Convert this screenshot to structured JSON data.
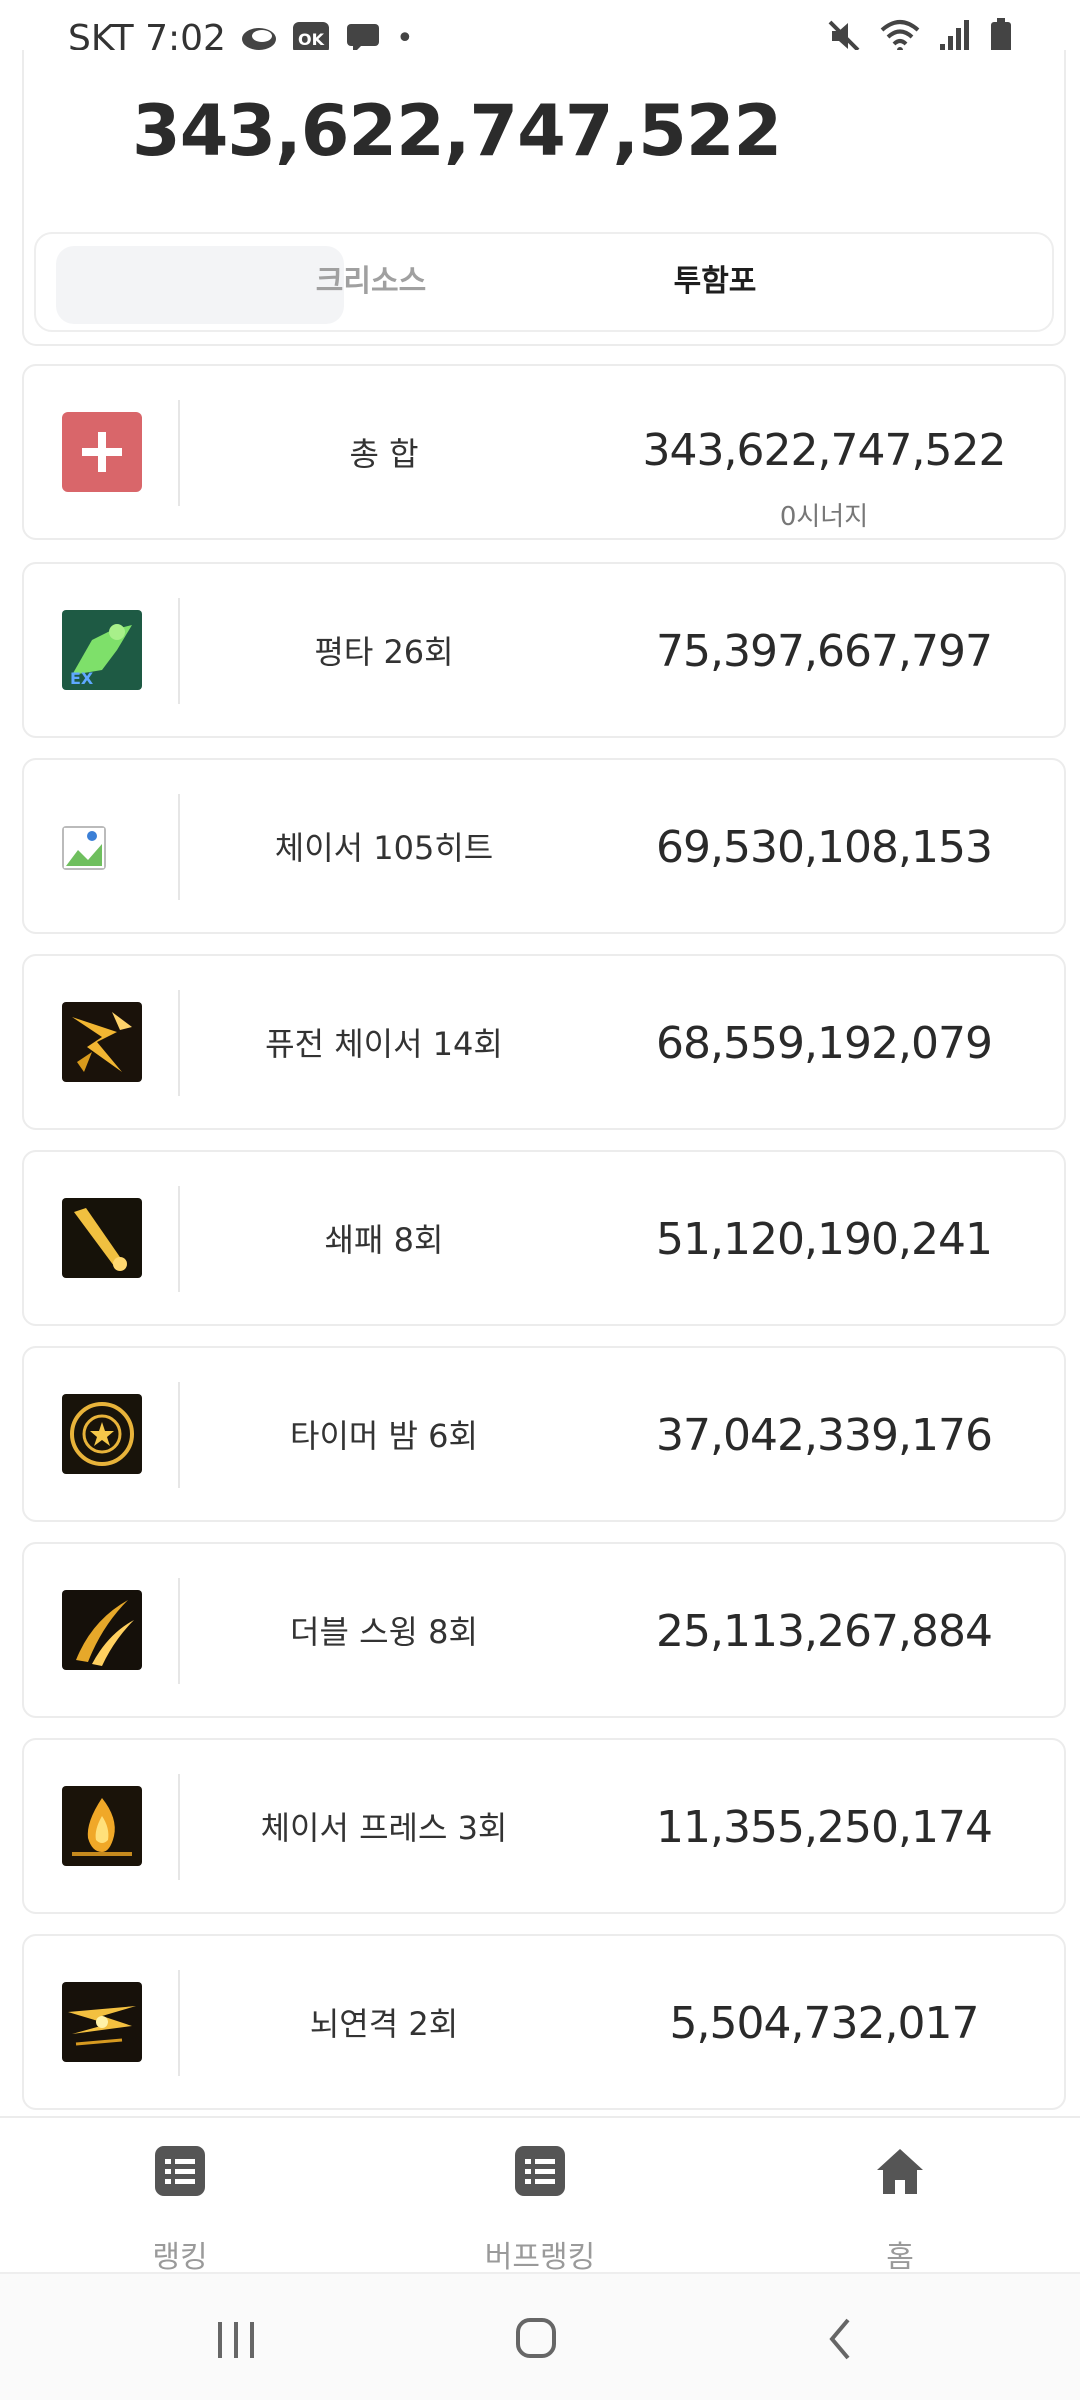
{
  "status_bar": {
    "time_label": "SKT 7:02",
    "icons": [
      "cloud-icon",
      "ok-icon",
      "message-icon",
      "dot-icon"
    ],
    "right_icons": [
      "mute-icon",
      "wifi-icon",
      "signal-icon",
      "battery-icon"
    ]
  },
  "summary": {
    "total_damage": "343,622,747,522",
    "class_options": [
      "크리소스",
      "투함포"
    ],
    "selected_class": "투함포"
  },
  "rows": [
    {
      "label": "총 합",
      "value": "343,622,747,522",
      "sub": "0시너지",
      "icon": "plus-icon"
    },
    {
      "label": "평타 26회",
      "value": "75,397,667,797",
      "icon": "basic-attack-skill-icon"
    },
    {
      "label": "체이서 105히트",
      "value": "69,530,108,153",
      "icon": "broken-image-icon"
    },
    {
      "label": "퓨전 체이서 14회",
      "value": "68,559,192,079",
      "icon": "fusion-chaser-skill-icon"
    },
    {
      "label": "쇄패 8회",
      "value": "51,120,190,241",
      "icon": "swing-club-skill-icon"
    },
    {
      "label": "타이머 밤 6회",
      "value": "37,042,339,176",
      "icon": "timer-bomb-skill-icon"
    },
    {
      "label": "더블 스윙 8회",
      "value": "25,113,267,884",
      "icon": "double-swing-skill-icon"
    },
    {
      "label": "체이서 프레스 3회",
      "value": "11,355,250,174",
      "icon": "chaser-press-skill-icon"
    },
    {
      "label": "뇌연격 2회",
      "value": "5,504,732,017",
      "icon": "thunder-strike-skill-icon"
    }
  ],
  "bottom_nav": [
    {
      "label": "랭킹",
      "icon": "list-icon"
    },
    {
      "label": "버프랭킹",
      "icon": "list-icon"
    },
    {
      "label": "홈",
      "icon": "home-icon"
    }
  ],
  "system_nav": [
    "recent-apps-icon",
    "home-circle-icon",
    "back-icon"
  ]
}
